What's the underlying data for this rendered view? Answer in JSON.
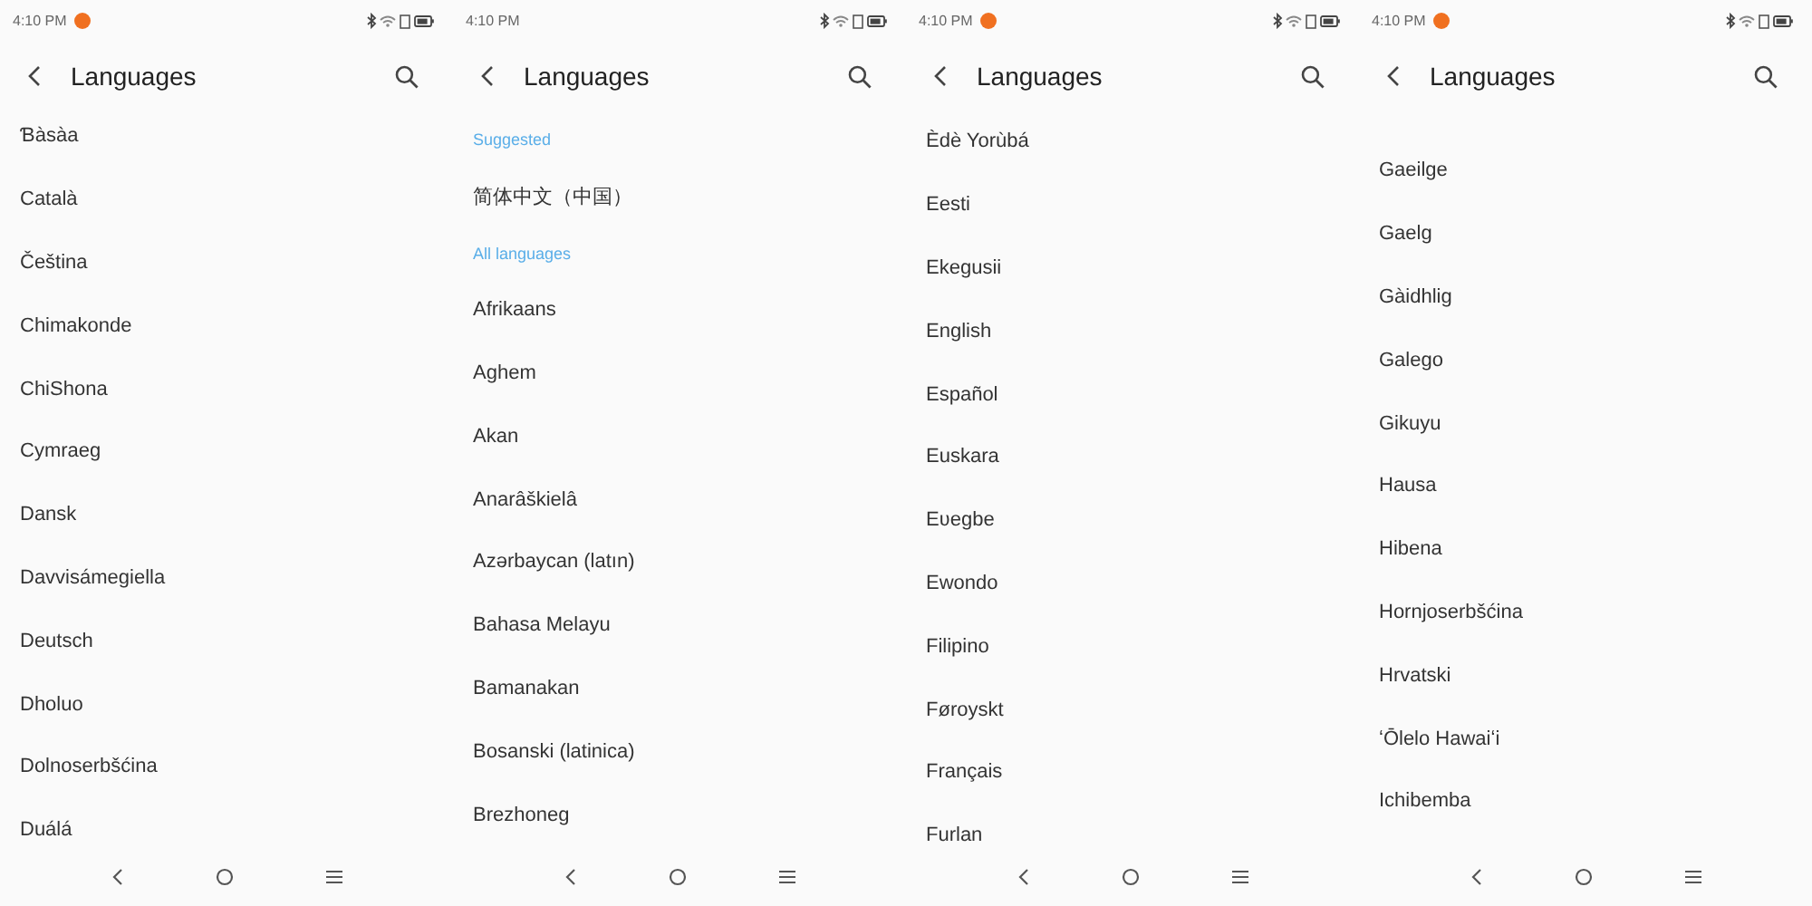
{
  "screens": [
    {
      "status_time": "4:10 PM",
      "notification_dot": true,
      "title": "Languages",
      "items": [
        {
          "kind": "language",
          "label": "Ɓàsàa"
        },
        {
          "kind": "language",
          "label": "Català"
        },
        {
          "kind": "language",
          "label": "Čeština"
        },
        {
          "kind": "language",
          "label": "Chimakonde"
        },
        {
          "kind": "language",
          "label": "ChiShona"
        },
        {
          "kind": "language",
          "label": "Cymraeg"
        },
        {
          "kind": "language",
          "label": "Dansk"
        },
        {
          "kind": "language",
          "label": "Davvisámegiella"
        },
        {
          "kind": "language",
          "label": "Deutsch"
        },
        {
          "kind": "language",
          "label": "Dholuo"
        },
        {
          "kind": "language",
          "label": "Dolnoserbšćina"
        },
        {
          "kind": "language",
          "label": "Duálá"
        }
      ]
    },
    {
      "status_time": "4:10 PM",
      "notification_dot": false,
      "title": "Languages",
      "items": [
        {
          "kind": "section",
          "label": "Suggested"
        },
        {
          "kind": "language",
          "label": "简体中文（中国）"
        },
        {
          "kind": "section",
          "label": "All languages"
        },
        {
          "kind": "language",
          "label": "Afrikaans"
        },
        {
          "kind": "language",
          "label": "Aghem"
        },
        {
          "kind": "language",
          "label": "Akan"
        },
        {
          "kind": "language",
          "label": "Anarâškielâ"
        },
        {
          "kind": "language",
          "label": "Azərbaycan (latın)"
        },
        {
          "kind": "language",
          "label": "Bahasa Melayu"
        },
        {
          "kind": "language",
          "label": "Bamanakan"
        },
        {
          "kind": "language",
          "label": "Bosanski (latinica)"
        },
        {
          "kind": "language",
          "label": "Brezhoneg"
        }
      ]
    },
    {
      "status_time": "4:10 PM",
      "notification_dot": true,
      "title": "Languages",
      "items": [
        {
          "kind": "language",
          "label": "Èdè Yorùbá"
        },
        {
          "kind": "language",
          "label": "Eesti"
        },
        {
          "kind": "language",
          "label": "Ekegusii"
        },
        {
          "kind": "language",
          "label": "English"
        },
        {
          "kind": "language",
          "label": "Español"
        },
        {
          "kind": "language",
          "label": "Euskara"
        },
        {
          "kind": "language",
          "label": "Eʋegbe"
        },
        {
          "kind": "language",
          "label": "Ewondo"
        },
        {
          "kind": "language",
          "label": "Filipino"
        },
        {
          "kind": "language",
          "label": "Føroyskt"
        },
        {
          "kind": "language",
          "label": "Français"
        },
        {
          "kind": "language",
          "label": "Furlan"
        }
      ]
    },
    {
      "status_time": "4:10 PM",
      "notification_dot": true,
      "title": "Languages",
      "items": [
        {
          "kind": "language",
          "label": "Gaeilge"
        },
        {
          "kind": "language",
          "label": "Gaelg"
        },
        {
          "kind": "language",
          "label": "Gàidhlig"
        },
        {
          "kind": "language",
          "label": "Galego"
        },
        {
          "kind": "language",
          "label": "Gikuyu"
        },
        {
          "kind": "language",
          "label": "Hausa"
        },
        {
          "kind": "language",
          "label": "Hibena"
        },
        {
          "kind": "language",
          "label": "Hornjoserbšćina"
        },
        {
          "kind": "language",
          "label": "Hrvatski"
        },
        {
          "kind": "language",
          "label": "ʻŌlelo Hawaiʻi"
        },
        {
          "kind": "language",
          "label": "Ichibemba"
        }
      ]
    }
  ]
}
